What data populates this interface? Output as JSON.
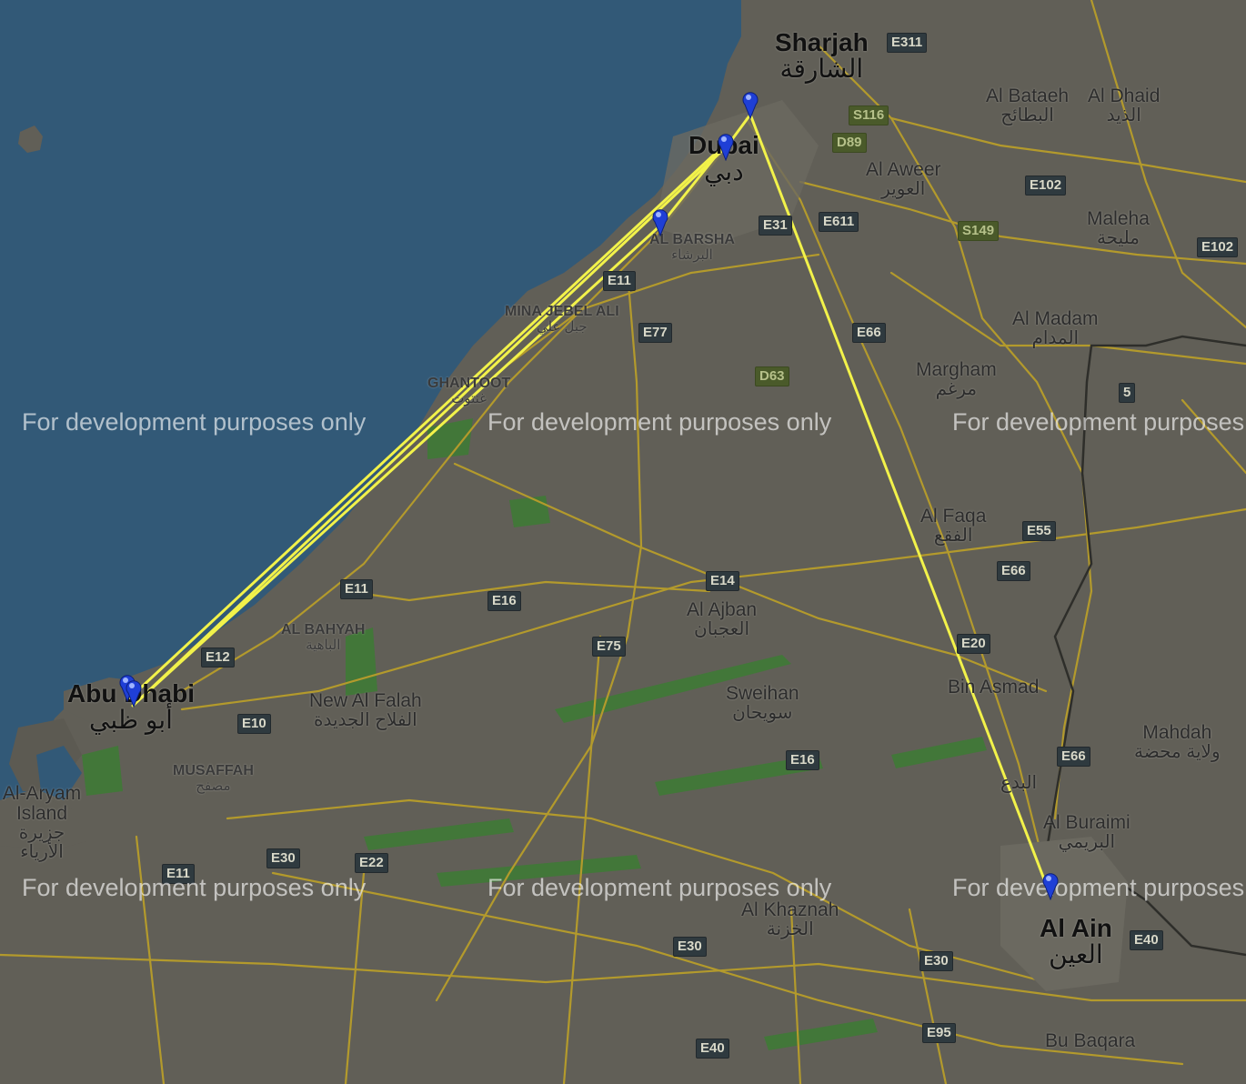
{
  "watermark": "For development purposes only",
  "colors": {
    "sea": "#325977",
    "land": "#615f57",
    "road": "#b39a2c",
    "route": "#f2f24a",
    "marker": "#1f3fd6",
    "shield_bg": "#2f3a3f",
    "green": "#3f7a36"
  },
  "places": {
    "sharjah": {
      "en": "Sharjah",
      "ar": "الشارقة"
    },
    "dubai": {
      "en": "Dubai",
      "ar": "دبي"
    },
    "abu_dhabi": {
      "en": "Abu Dhabi",
      "ar": "أبو ظبي"
    },
    "al_ain": {
      "en": "Al Ain",
      "ar": "العين"
    },
    "al_bataeh": {
      "en": "Al Bataeh",
      "ar": "البطائح"
    },
    "al_dhaid": {
      "en": "Al Dhaid",
      "ar": "الذيد"
    },
    "al_aweer": {
      "en": "Al Aweer",
      "ar": "العوير"
    },
    "maleha": {
      "en": "Maleha",
      "ar": "مليحة"
    },
    "al_madam": {
      "en": "Al Madam",
      "ar": "المدام"
    },
    "margham": {
      "en": "Margham",
      "ar": "مرغم"
    },
    "al_faqa": {
      "en": "Al Faqa",
      "ar": "الفقع"
    },
    "al_ajban": {
      "en": "Al Ajban",
      "ar": "العجبان"
    },
    "sweihan": {
      "en": "Sweihan",
      "ar": "سويحان"
    },
    "bin_asmad": {
      "en": "Bin Asmad",
      "ar": ""
    },
    "al_bidaa": {
      "en": "",
      "ar": "البدع"
    },
    "mahdah": {
      "en": "Mahdah",
      "ar": "ولاية محضة"
    },
    "al_buraimi": {
      "en": "Al Buraimi",
      "ar": "البريمي"
    },
    "al_khaznah": {
      "en": "Al Khaznah",
      "ar": "الخزنة"
    },
    "bu_baqara": {
      "en": "Bu Baqara",
      "ar": ""
    },
    "new_al_falah": {
      "en": "New Al Falah",
      "ar": "الفلاح الجديدة"
    },
    "al_aryam": {
      "en": "Al-Aryam Island",
      "ar": "جزيرة الأرياء"
    },
    "al_barsha": {
      "en": "AL BARSHA",
      "ar": "البرشاء"
    },
    "mina_jebel_ali": {
      "en": "MINA JEBEL ALI",
      "ar": "جبل علي"
    },
    "ghantoot": {
      "en": "GHANTOOT",
      "ar": "غنتوت"
    },
    "al_bahyah": {
      "en": "AL BAHYAH",
      "ar": "الباهية"
    },
    "musaffah": {
      "en": "MUSAFFAH",
      "ar": "مصفح"
    }
  },
  "shields": [
    "E311",
    "S116",
    "D89",
    "E102",
    "E611",
    "S149",
    "E31",
    "E11",
    "E77",
    "E66",
    "D63",
    "5",
    "E55",
    "E14",
    "E16",
    "E75",
    "E20",
    "E12",
    "E10",
    "E16",
    "E30",
    "E22",
    "E11",
    "E30",
    "E30",
    "E40",
    "E95",
    "E40",
    "E102",
    "E66",
    "E11"
  ],
  "route": {
    "stops": [
      {
        "name": "Abu Dhabi stop 1",
        "lat": 24.47,
        "lon": 54.37
      },
      {
        "name": "Dubai stop 1",
        "lat": 25.2,
        "lon": 55.27
      },
      {
        "name": "Al Barsha stop",
        "lat": 25.11,
        "lon": 55.2
      },
      {
        "name": "Abu Dhabi stop 2",
        "lat": 24.46,
        "lon": 54.38
      },
      {
        "name": "Dubai stop 2",
        "lat": 25.2,
        "lon": 55.27
      },
      {
        "name": "Sharjah/Deira stop",
        "lat": 25.26,
        "lon": 55.3
      },
      {
        "name": "Al Ain stop",
        "lat": 24.21,
        "lon": 55.74
      }
    ]
  }
}
